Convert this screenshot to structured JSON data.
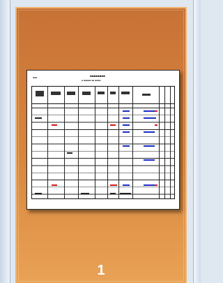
{
  "slide_panel": {
    "selected_slide_number": "1",
    "colors": {
      "selected_bg_top": "#c87236",
      "selected_bg_bottom": "#e9a256",
      "selected_border": "#f1b46d",
      "panel_bg": "#dfe7f1"
    }
  },
  "thumbnail": {
    "content": "spreadsheet-style table page preview"
  }
}
